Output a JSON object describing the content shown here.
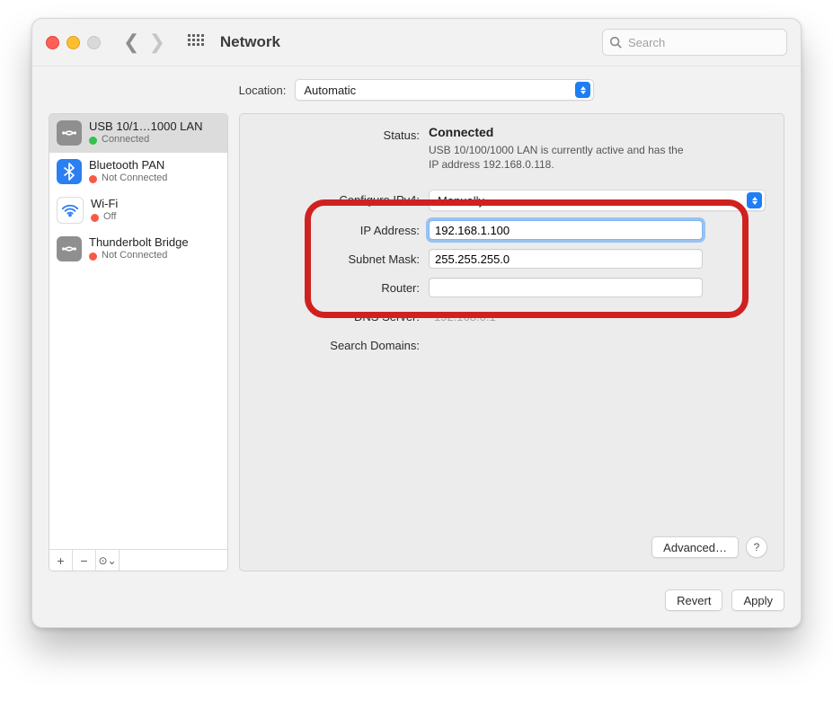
{
  "window": {
    "title": "Network"
  },
  "search": {
    "placeholder": "Search"
  },
  "location": {
    "label": "Location:",
    "value": "Automatic"
  },
  "sidebar": {
    "items": [
      {
        "name": "USB 10/1…1000 LAN",
        "status_label": "Connected",
        "status_color": "green",
        "icon": "ethernet",
        "selected": true
      },
      {
        "name": "Bluetooth PAN",
        "status_label": "Not Connected",
        "status_color": "red",
        "icon": "bluetooth",
        "selected": false
      },
      {
        "name": "Wi-Fi",
        "status_label": "Off",
        "status_color": "red",
        "icon": "wifi",
        "selected": false
      },
      {
        "name": "Thunderbolt Bridge",
        "status_label": "Not Connected",
        "status_color": "red",
        "icon": "ethernet",
        "selected": false
      }
    ],
    "toolbar": {
      "add": "+",
      "remove": "−",
      "actions": "⊙⌄"
    }
  },
  "detail": {
    "status_label": "Status:",
    "status_value": "Connected",
    "status_desc": "USB 10/100/1000 LAN is currently active and has the IP address 192.168.0.118.",
    "configure_label": "Configure IPv4:",
    "configure_value": "Manually",
    "ip_label": "IP Address:",
    "ip_value": "192.168.1.100",
    "subnet_label": "Subnet Mask:",
    "subnet_value": "255.255.255.0",
    "router_label": "Router:",
    "router_value": "",
    "dns_label": "DNS Server:",
    "dns_placeholder": "192.168.0.1",
    "search_domains_label": "Search Domains:",
    "advanced_label": "Advanced…"
  },
  "footer": {
    "revert": "Revert",
    "apply": "Apply"
  }
}
